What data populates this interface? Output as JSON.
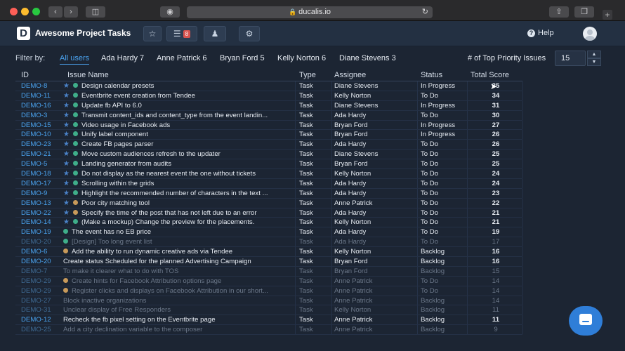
{
  "browser": {
    "url": "ducalis.io"
  },
  "app": {
    "logo_letter": "D",
    "title": "Awesome Project Tasks",
    "toolbar_badge": "8",
    "help_label": "Help"
  },
  "filter": {
    "label": "Filter by:",
    "chips": [
      "All users",
      "Ada Hardy 7",
      "Anne Patrick 6",
      "Bryan Ford 5",
      "Kelly Norton 6",
      "Diane Stevens 3"
    ],
    "top_priority_label": "# of Top Priority Issues",
    "top_priority_value": "15"
  },
  "columns": [
    "ID",
    "Issue Name",
    "Type",
    "Assignee",
    "Status",
    "Total Score"
  ],
  "rows": [
    {
      "id": "DEMO-8",
      "name": "Design calendar presets",
      "type": "Task",
      "assignee": "Diane Stevens",
      "status": "In Progress",
      "score": "35",
      "star": true,
      "dot": "green",
      "dim": false
    },
    {
      "id": "DEMO-11",
      "name": "Eventbrite event creation from Tendee",
      "type": "Task",
      "assignee": "Kelly Norton",
      "status": "To Do",
      "score": "34",
      "star": true,
      "dot": "green",
      "dim": false
    },
    {
      "id": "DEMO-16",
      "name": "Update fb API to 6.0",
      "type": "Task",
      "assignee": "Diane Stevens",
      "status": "In Progress",
      "score": "31",
      "star": true,
      "dot": "green",
      "dim": false
    },
    {
      "id": "DEMO-3",
      "name": "Transmit content_ids and content_type from the event landin...",
      "type": "Task",
      "assignee": "Ada Hardy",
      "status": "To Do",
      "score": "30",
      "star": true,
      "dot": "green",
      "dim": false
    },
    {
      "id": "DEMO-15",
      "name": "Video usage in Facebook ads",
      "type": "Task",
      "assignee": "Bryan Ford",
      "status": "In Progress",
      "score": "27",
      "star": true,
      "dot": "green",
      "dim": false
    },
    {
      "id": "DEMO-10",
      "name": "Unify label component",
      "type": "Task",
      "assignee": "Bryan Ford",
      "status": "In Progress",
      "score": "26",
      "star": true,
      "dot": "green",
      "dim": false
    },
    {
      "id": "DEMO-23",
      "name": "Create FB pages parser",
      "type": "Task",
      "assignee": "Ada Hardy",
      "status": "To Do",
      "score": "26",
      "star": true,
      "dot": "green",
      "dim": false
    },
    {
      "id": "DEMO-21",
      "name": "Move custom audiences refresh to the updater",
      "type": "Task",
      "assignee": "Diane Stevens",
      "status": "To Do",
      "score": "25",
      "star": true,
      "dot": "green",
      "dim": false
    },
    {
      "id": "DEMO-5",
      "name": "Landing generator from audits",
      "type": "Task",
      "assignee": "Bryan Ford",
      "status": "To Do",
      "score": "25",
      "star": true,
      "dot": "green",
      "dim": false
    },
    {
      "id": "DEMO-18",
      "name": "Do not display as the nearest event the one without tickets",
      "type": "Task",
      "assignee": "Kelly Norton",
      "status": "To Do",
      "score": "24",
      "star": true,
      "dot": "green",
      "dim": false
    },
    {
      "id": "DEMO-17",
      "name": "Scrolling within the grids",
      "type": "Task",
      "assignee": "Ada Hardy",
      "status": "To Do",
      "score": "24",
      "star": true,
      "dot": "green",
      "dim": false
    },
    {
      "id": "DEMO-9",
      "name": "Highlight the recommended number of characters in the text ...",
      "type": "Task",
      "assignee": "Ada Hardy",
      "status": "To Do",
      "score": "23",
      "star": true,
      "dot": "green",
      "dim": false
    },
    {
      "id": "DEMO-13",
      "name": "Poor city matching tool",
      "type": "Task",
      "assignee": "Anne Patrick",
      "status": "To Do",
      "score": "22",
      "star": true,
      "dot": "orange",
      "dim": false
    },
    {
      "id": "DEMO-22",
      "name": "Specify the time of the post that has not left due to an error",
      "type": "Task",
      "assignee": "Ada Hardy",
      "status": "To Do",
      "score": "21",
      "star": true,
      "dot": "orange",
      "dim": false
    },
    {
      "id": "DEMO-14",
      "name": "(Make a mockup) Change the preview for the placements.",
      "type": "Task",
      "assignee": "Kelly Norton",
      "status": "To Do",
      "score": "21",
      "star": true,
      "dot": "green",
      "dim": false
    },
    {
      "id": "DEMO-19",
      "name": "The event has no EB price",
      "type": "Task",
      "assignee": "Ada Hardy",
      "status": "To Do",
      "score": "19",
      "star": false,
      "dot": "green",
      "dim": false
    },
    {
      "id": "DEMO-20",
      "name": "[Design] Too long event list",
      "type": "Task",
      "assignee": "Ada Hardy",
      "status": "To Do",
      "score": "17",
      "star": false,
      "dot": "green",
      "dim": true
    },
    {
      "id": "DEMO-6",
      "name": "Add the ability to run dynamic creative ads via Tendee",
      "type": "Task",
      "assignee": "Kelly Norton",
      "status": "Backlog",
      "score": "16",
      "star": false,
      "dot": "orange",
      "dim": false
    },
    {
      "id": "DEMO-20",
      "name": "Create status Scheduled for the planned Advertising Campaign",
      "type": "Task",
      "assignee": "Bryan Ford",
      "status": "Backlog",
      "score": "16",
      "star": false,
      "dot": "none",
      "dim": false
    },
    {
      "id": "DEMO-7",
      "name": "To make it clearer what to do with TOS",
      "type": "Task",
      "assignee": "Bryan Ford",
      "status": "Backlog",
      "score": "15",
      "star": false,
      "dot": "none",
      "dim": true
    },
    {
      "id": "DEMO-29",
      "name": "Create hints for Facebook Attribution options page",
      "type": "Task",
      "assignee": "Anne Patrick",
      "status": "To Do",
      "score": "14",
      "star": false,
      "dot": "orange",
      "dim": true
    },
    {
      "id": "DEMO-29",
      "name": "Register clicks and displays on Facebook Attribution in our short...",
      "type": "Task",
      "assignee": "Anne Patrick",
      "status": "To Do",
      "score": "14",
      "star": false,
      "dot": "orange",
      "dim": true
    },
    {
      "id": "DEMO-27",
      "name": "Block inactive organizations",
      "type": "Task",
      "assignee": "Anne Patrick",
      "status": "Backlog",
      "score": "14",
      "star": false,
      "dot": "none",
      "dim": true
    },
    {
      "id": "DEMO-31",
      "name": "Unclear display of Free Responders",
      "type": "Task",
      "assignee": "Kelly Norton",
      "status": "Backlog",
      "score": "11",
      "star": false,
      "dot": "none",
      "dim": true
    },
    {
      "id": "DEMO-12",
      "name": "Recheck the fb pixel setting on the Eventbrite page",
      "type": "Task",
      "assignee": "Anne Patrick",
      "status": "Backlog",
      "score": "11",
      "star": false,
      "dot": "none",
      "dim": false
    },
    {
      "id": "DEMO-25",
      "name": "Add a city declination variable to the composer",
      "type": "Task",
      "assignee": "Anne Patrick",
      "status": "Backlog",
      "score": "9",
      "star": false,
      "dot": "none",
      "dim": true
    }
  ]
}
